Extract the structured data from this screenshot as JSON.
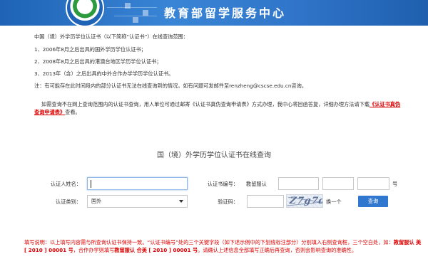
{
  "header": {
    "brand": "教育部留学服务中心",
    "icons": {
      "logo": "cscse-emblem"
    }
  },
  "notice": {
    "line1": "中国（境）外学历学位认证书（以下简称“认证书”）在线查询范围：",
    "line2": "1、2006年8月之后出具的国外学历学位认证书；",
    "line3": "2、2008年8月之后出具的港澳台地区学历学位认证书；",
    "line4": "3、2013年（含）之后出具的中外合作办学学历学位认证书。",
    "line5": "注：有可能存在此时间段内的部分认证书无法在线查询到的情况，如有问题可发邮件至renzheng@cscse.edu.cn咨询。",
    "para_text": "如需查询不在网上查询范围内的认证书查询，用人单位可通过邮寄《认证书真伪查询申请表》方式办理，我中心将回函答复，详细办理方法请下载",
    "para_link": "《认证书真伪查询申请表》",
    "para_tail": "查看。"
  },
  "query": {
    "title": "国（境）外学历学位认证书在线查询",
    "name_label": "认证人姓名：",
    "name_value": "",
    "cert_label": "认证书编号：",
    "cert_prefix": "教留服认",
    "cert_suffix": "号",
    "cert_parts": [
      "",
      "",
      ""
    ],
    "type_label": "认证类别：",
    "type_selected": "国外",
    "captcha_label": "验证码：",
    "captcha_value": "",
    "captcha_image_text": "Z7g7d8",
    "refresh_label": "换一个",
    "submit_label": "查询"
  },
  "instructions": {
    "text1": "填写说明：以上填写内容需与所查询认证书保持一致。“认证书编号”处的三个关键字段（如下述示例中的下划线标注部分）分别填入右侧查询框，三个空白处，如：",
    "example1": "教留服认 美 [ 2010 ] 00001 号",
    "text2": "，合作办学则填写",
    "example2": "教留服认 合美 [ 2010 ] 00001 号",
    "text3": "。请确认上述信息全部填写正确后再查询，否则会影响查询的准确性。"
  },
  "colors": {
    "banner": "#2f74c8",
    "link_red": "#dd0000",
    "button": "#3077cf"
  }
}
